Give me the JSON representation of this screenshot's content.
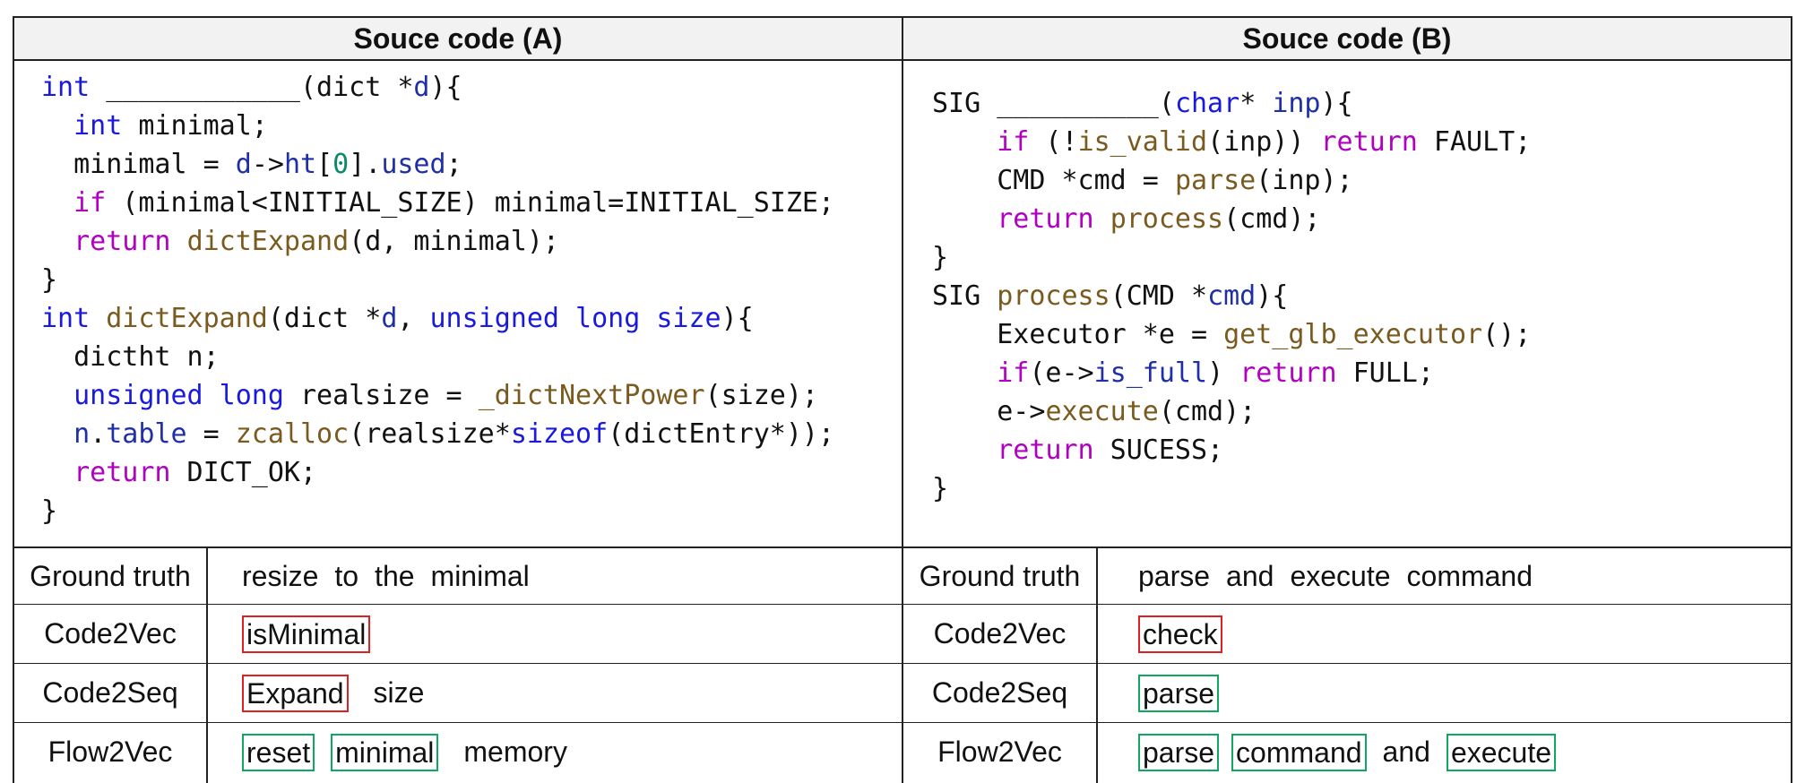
{
  "headers": {
    "a": "Souce code (A)",
    "b": "Souce code (B)"
  },
  "code_a": {
    "l1": {
      "t0": "int",
      "t1": " ____________(dict *",
      "t2": "d",
      "t3": "){"
    },
    "l2": {
      "t0": "  ",
      "t1": "int",
      "t2": " minimal;"
    },
    "l3": {
      "t0": "  minimal = ",
      "t1": "d",
      "t2": "->",
      "t3": "ht",
      "t4": "[",
      "t5": "0",
      "t6": "].",
      "t7": "used",
      "t8": ";"
    },
    "l4": {
      "t0": "  ",
      "t1": "if",
      "t2": " (minimal<INITIAL_SIZE) minimal=INITIAL_SIZE;"
    },
    "l5": {
      "t0": "  ",
      "t1": "return",
      "t2": " ",
      "t3": "dictExpand",
      "t4": "(d, minimal);"
    },
    "l6": {
      "t0": "}"
    },
    "l7": {
      "t0": "int",
      "t1": " ",
      "t2": "dictExpand",
      "t3": "(dict *",
      "t4": "d",
      "t5": ", ",
      "t6": "unsigned long size",
      "t7": "){"
    },
    "l8": {
      "t0": "  dictht n;"
    },
    "l9": {
      "t0": "  ",
      "t1": "unsigned long",
      "t2": " realsize = ",
      "t3": "_dictNextPower",
      "t4": "(size);"
    },
    "l10": {
      "t0": "  ",
      "t1": "n",
      "t2": ".",
      "t3": "table",
      "t4": " = ",
      "t5": "zcalloc",
      "t6": "(realsize*",
      "t7": "sizeof",
      "t8": "(dictEntry*));"
    },
    "l11": {
      "t0": "  ",
      "t1": "return",
      "t2": " DICT_OK;"
    },
    "l12": {
      "t0": "}"
    }
  },
  "code_b": {
    "l1": {
      "t0": "SIG __________(",
      "t1": "char",
      "t2": "* ",
      "t3": "inp",
      "t4": "){"
    },
    "l2": {
      "t0": "    ",
      "t1": "if",
      "t2": " (!",
      "t3": "is_valid",
      "t4": "(inp)) ",
      "t5": "return",
      "t6": " FAULT;"
    },
    "l3": {
      "t0": "    CMD *cmd = ",
      "t1": "parse",
      "t2": "(inp);"
    },
    "l4": {
      "t0": "    ",
      "t1": "return",
      "t2": " ",
      "t3": "process",
      "t4": "(cmd);"
    },
    "l5": {
      "t0": "}"
    },
    "l6": {
      "t0": "SIG ",
      "t1": "process",
      "t2": "(CMD *",
      "t3": "cmd",
      "t4": "){"
    },
    "l7": {
      "t0": "    Executor *e = ",
      "t1": "get_glb_executor",
      "t2": "();"
    },
    "l8": {
      "t0": "    ",
      "t1": "if",
      "t2": "(e->",
      "t3": "is_full",
      "t4": ") ",
      "t5": "return",
      "t6": " FULL;"
    },
    "l9": {
      "t0": "    e->",
      "t1": "execute",
      "t2": "(cmd);"
    },
    "l10": {
      "t0": "    ",
      "t1": "return",
      "t2": " SUCESS;"
    },
    "l11": {
      "t0": "}"
    }
  },
  "rows": [
    {
      "label": "Ground truth",
      "a": [
        "resize",
        "to",
        "the",
        "minimal"
      ],
      "b": [
        "parse",
        "and",
        "execute",
        "command"
      ]
    },
    {
      "label": "Code2Vec",
      "a": [
        {
          "text": "isMinimal",
          "mark": "wrong"
        }
      ],
      "b": [
        {
          "text": "check",
          "mark": "wrong"
        }
      ]
    },
    {
      "label": "Code2Seq",
      "a": [
        {
          "text": "Expand",
          "mark": "wrong"
        },
        {
          "text": "size",
          "mark": "none"
        }
      ],
      "b": [
        {
          "text": "parse",
          "mark": "correct"
        }
      ]
    },
    {
      "label": "Flow2Vec",
      "a": [
        {
          "text": "reset",
          "mark": "correct"
        },
        {
          "text": "minimal",
          "mark": "correct"
        },
        {
          "text": "memory",
          "mark": "none"
        }
      ],
      "b": [
        {
          "text": "parse",
          "mark": "correct"
        },
        {
          "text": "command",
          "mark": "correct"
        },
        {
          "text": "and",
          "mark": "none"
        },
        {
          "text": "execute",
          "mark": "correct"
        }
      ]
    }
  ],
  "colors": {
    "wrong_box": "#e02020",
    "correct_box": "#10a860",
    "keyword": "#1a1adf",
    "control": "#b000c0",
    "function": "#7a5a1e"
  }
}
